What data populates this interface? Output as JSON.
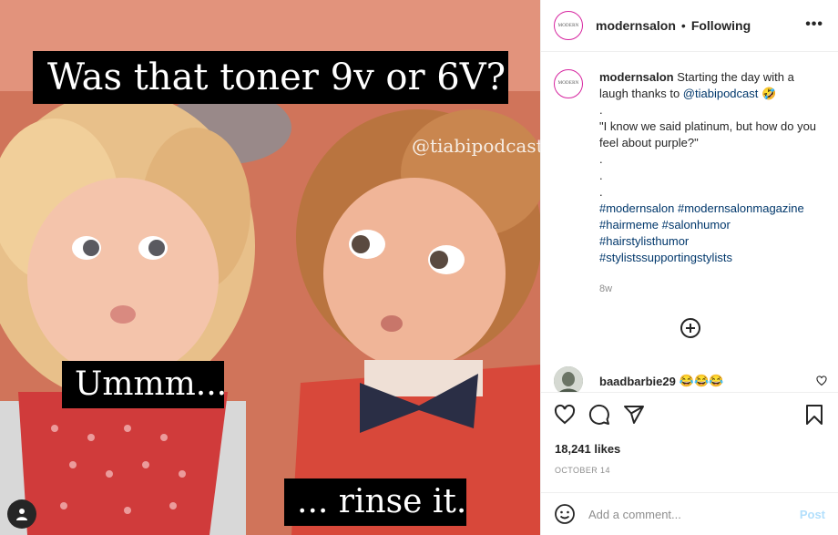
{
  "media": {
    "caption_top": "Was that toner 9v or 6V?",
    "caption_mid": "Ummm...",
    "caption_bottom": "... rinse it.",
    "watermark": "@tiabipodcast",
    "tag_icon": "user-tag-icon"
  },
  "header": {
    "avatar_text": "MODERN",
    "username": "modernsalon",
    "separator": "•",
    "follow_status": "Following",
    "more_icon": "more-options-icon",
    "more_glyph": "•••"
  },
  "caption": {
    "username": "modernsalon",
    "text_1": " Starting the day with a laugh thanks to ",
    "mention": "@tiabipodcast",
    "emoji": "🤣",
    "dot1": ".",
    "quote": "\"I know we said platinum, but how do you feel about purple?\"",
    "dot2": ".",
    "dot3": ".",
    "dot4": ".",
    "hashtags_1": "#modernsalon #modernsalonmagazine",
    "hashtags_2": "#hairmeme #salonhumor",
    "hashtags_3": "#hairstylisthumor",
    "hashtags_4": "#stylistssupportingstylists",
    "time": "8w"
  },
  "comment": {
    "username": "baadbarbie29",
    "text": "😂😂😂"
  },
  "actions": {
    "like_icon": "heart-icon",
    "comment_icon": "comment-icon",
    "share_icon": "share-icon",
    "save_icon": "bookmark-icon",
    "likes": "18,241 likes",
    "date": "OCTOBER 14"
  },
  "add_comment": {
    "emoji_icon": "emoji-icon",
    "placeholder": "Add a comment...",
    "post_label": "Post"
  }
}
